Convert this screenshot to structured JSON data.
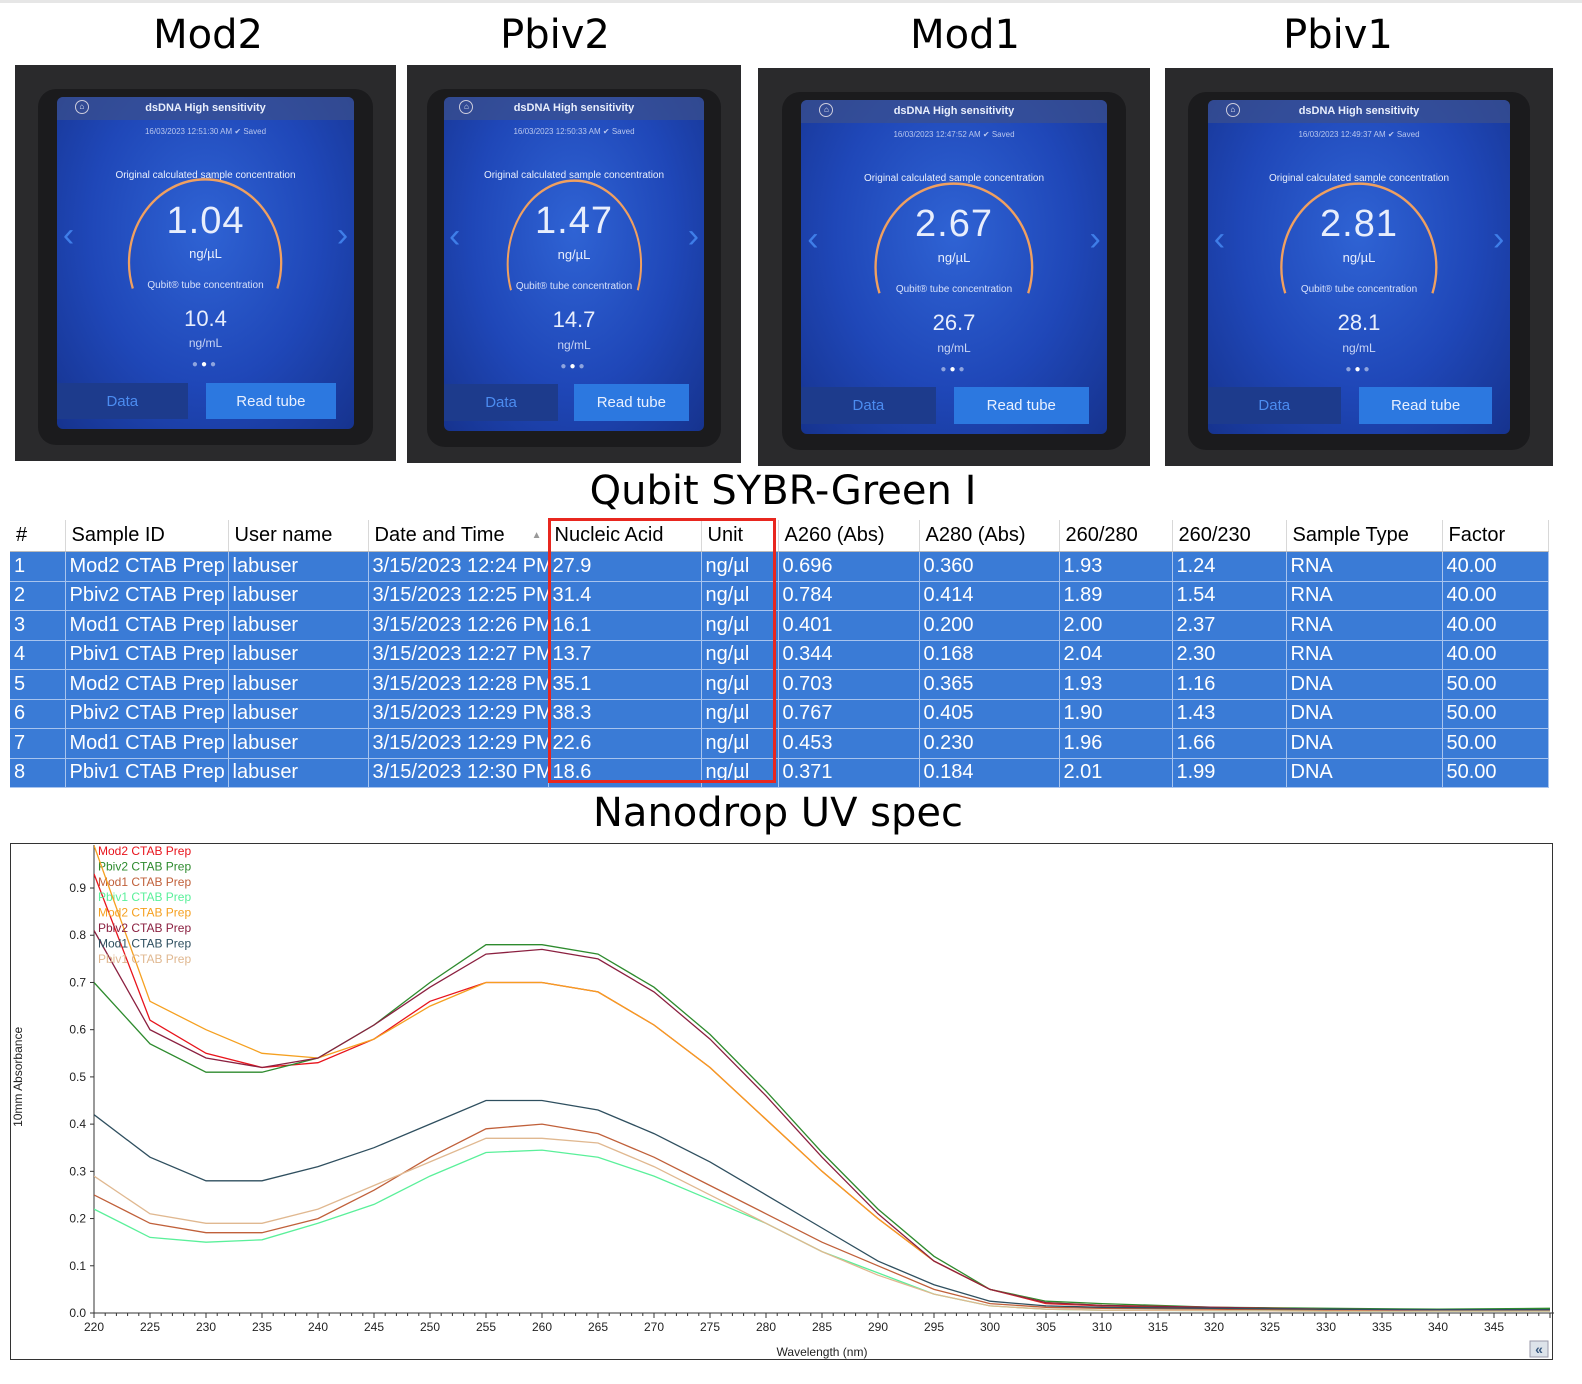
{
  "photos": [
    {
      "title": "Mod2",
      "header": "dsDNA High sensitivity",
      "timestamp": "16/03/2023 12:51:30 AM",
      "saved": "Saved",
      "orig_label": "Original calculated sample concentration",
      "value": "1.04",
      "unit": "ng/µL",
      "tube_label": "Qubit® tube concentration",
      "tube_value": "10.4",
      "tube_unit": "ng/mL",
      "data_btn": "Data",
      "read_btn": "Read tube"
    },
    {
      "title": "Pbiv2",
      "header": "dsDNA High sensitivity",
      "timestamp": "16/03/2023 12:50:33 AM",
      "saved": "Saved",
      "orig_label": "Original calculated sample concentration",
      "value": "1.47",
      "unit": "ng/µL",
      "tube_label": "Qubit® tube concentration",
      "tube_value": "14.7",
      "tube_unit": "ng/mL",
      "data_btn": "Data",
      "read_btn": "Read tube"
    },
    {
      "title": "Mod1",
      "header": "dsDNA High sensitivity",
      "timestamp": "16/03/2023 12:47:52 AM",
      "saved": "Saved",
      "orig_label": "Original calculated sample concentration",
      "value": "2.67",
      "unit": "ng/µL",
      "tube_label": "Qubit® tube concentration",
      "tube_value": "26.7",
      "tube_unit": "ng/mL",
      "data_btn": "Data",
      "read_btn": "Read tube"
    },
    {
      "title": "Pbiv1",
      "header": "dsDNA High sensitivity",
      "timestamp": "16/03/2023 12:49:37 AM",
      "saved": "Saved",
      "orig_label": "Original calculated sample concentration",
      "value": "2.81",
      "unit": "ng/µL",
      "tube_label": "Qubit® tube concentration",
      "tube_value": "28.1",
      "tube_unit": "ng/mL",
      "data_btn": "Data",
      "read_btn": "Read tube"
    }
  ],
  "qubit_title": "Qubit SYBR-Green I",
  "table": {
    "headers": [
      "#",
      "Sample ID",
      "User name",
      "Date and Time",
      "Nucleic Acid",
      "Unit",
      "A260 (Abs)",
      "A280 (Abs)",
      "260/280",
      "260/230",
      "Sample Type",
      "Factor"
    ],
    "rows": [
      [
        "1",
        "Mod2 CTAB Prep",
        "labuser",
        "3/15/2023 12:24 PM",
        "27.9",
        "ng/µl",
        "0.696",
        "0.360",
        "1.93",
        "1.24",
        "RNA",
        "40.00"
      ],
      [
        "2",
        "Pbiv2 CTAB Prep",
        "labuser",
        "3/15/2023 12:25 PM",
        "31.4",
        "ng/µl",
        "0.784",
        "0.414",
        "1.89",
        "1.54",
        "RNA",
        "40.00"
      ],
      [
        "3",
        "Mod1 CTAB Prep",
        "labuser",
        "3/15/2023 12:26 PM",
        "16.1",
        "ng/µl",
        "0.401",
        "0.200",
        "2.00",
        "2.37",
        "RNA",
        "40.00"
      ],
      [
        "4",
        "Pbiv1 CTAB Prep",
        "labuser",
        "3/15/2023 12:27 PM",
        "13.7",
        "ng/µl",
        "0.344",
        "0.168",
        "2.04",
        "2.30",
        "RNA",
        "40.00"
      ],
      [
        "5",
        "Mod2 CTAB Prep",
        "labuser",
        "3/15/2023 12:28 PM",
        "35.1",
        "ng/µl",
        "0.703",
        "0.365",
        "1.93",
        "1.16",
        "DNA",
        "50.00"
      ],
      [
        "6",
        "Pbiv2 CTAB Prep",
        "labuser",
        "3/15/2023 12:29 PM",
        "38.3",
        "ng/µl",
        "0.767",
        "0.405",
        "1.90",
        "1.43",
        "DNA",
        "50.00"
      ],
      [
        "7",
        "Mod1 CTAB Prep",
        "labuser",
        "3/15/2023 12:29 PM",
        "22.6",
        "ng/µl",
        "0.453",
        "0.230",
        "1.96",
        "1.66",
        "DNA",
        "50.00"
      ],
      [
        "8",
        "Pbiv1 CTAB Prep",
        "labuser",
        "3/15/2023 12:30 PM",
        "18.6",
        "ng/µl",
        "0.371",
        "0.184",
        "2.01",
        "1.99",
        "DNA",
        "50.00"
      ]
    ],
    "highlight_color": "#e8271f",
    "row_color": "#3a7bd6"
  },
  "nanodrop_title": "Nanodrop UV spec",
  "chart_data": {
    "type": "line",
    "xlabel": "Wavelength (nm)",
    "ylabel": "10mm Absorbance",
    "xlim": [
      220,
      350
    ],
    "ylim": [
      0,
      0.99
    ],
    "xticks": [
      220,
      225,
      230,
      235,
      240,
      245,
      250,
      255,
      260,
      265,
      270,
      275,
      280,
      285,
      290,
      295,
      300,
      305,
      310,
      315,
      320,
      325,
      330,
      335,
      340,
      345
    ],
    "yticks": [
      "0.0",
      "0.1",
      "0.2",
      "0.3",
      "0.4",
      "0.5",
      "0.6",
      "0.7",
      "0.8",
      "0.9"
    ],
    "legend_position": "top-left",
    "x": [
      220,
      225,
      230,
      235,
      240,
      245,
      250,
      255,
      260,
      265,
      270,
      275,
      280,
      285,
      290,
      295,
      300,
      305,
      310,
      320,
      330,
      340,
      350
    ],
    "series": [
      {
        "name": "Mod2 CTAB Prep",
        "color": "#e8141c",
        "values": [
          0.93,
          0.62,
          0.55,
          0.52,
          0.53,
          0.58,
          0.66,
          0.7,
          0.7,
          0.68,
          0.61,
          0.52,
          0.41,
          0.3,
          0.2,
          0.11,
          0.05,
          0.02,
          0.015,
          0.01,
          0.006,
          0.005,
          0.005
        ]
      },
      {
        "name": "Pbiv2 CTAB Prep",
        "color": "#2e8b2e",
        "values": [
          0.7,
          0.57,
          0.51,
          0.51,
          0.54,
          0.61,
          0.7,
          0.78,
          0.78,
          0.76,
          0.69,
          0.59,
          0.47,
          0.34,
          0.22,
          0.12,
          0.05,
          0.025,
          0.02,
          0.012,
          0.01,
          0.008,
          0.01
        ]
      },
      {
        "name": "Mod1 CTAB Prep",
        "color": "#c0603a",
        "values": [
          0.25,
          0.19,
          0.17,
          0.17,
          0.2,
          0.26,
          0.33,
          0.39,
          0.4,
          0.38,
          0.33,
          0.27,
          0.21,
          0.15,
          0.1,
          0.05,
          0.02,
          0.012,
          0.01,
          0.008,
          0.006,
          0.005,
          0.005
        ]
      },
      {
        "name": "Pbiv1 CTAB Prep",
        "color": "#5af09a",
        "values": [
          0.22,
          0.16,
          0.15,
          0.155,
          0.19,
          0.23,
          0.29,
          0.34,
          0.345,
          0.33,
          0.29,
          0.24,
          0.19,
          0.13,
          0.085,
          0.04,
          0.015,
          0.008,
          0.006,
          0.005,
          0.004,
          0.004,
          0.004
        ]
      },
      {
        "name": "Mod2 CTAB Prep",
        "color": "#f5a020",
        "values": [
          0.99,
          0.66,
          0.6,
          0.55,
          0.54,
          0.58,
          0.65,
          0.7,
          0.7,
          0.68,
          0.61,
          0.52,
          0.41,
          0.3,
          0.2,
          0.11,
          0.05,
          0.022,
          0.016,
          0.012,
          0.008,
          0.006,
          0.006
        ]
      },
      {
        "name": "Pbiv2 CTAB Prep",
        "color": "#8b2040",
        "values": [
          0.81,
          0.6,
          0.54,
          0.52,
          0.54,
          0.61,
          0.69,
          0.76,
          0.77,
          0.75,
          0.68,
          0.58,
          0.46,
          0.33,
          0.21,
          0.11,
          0.05,
          0.022,
          0.016,
          0.012,
          0.008,
          0.006,
          0.006
        ]
      },
      {
        "name": "Mod1 CTAB Prep",
        "color": "#2f4f5f",
        "values": [
          0.42,
          0.33,
          0.28,
          0.28,
          0.31,
          0.35,
          0.4,
          0.45,
          0.45,
          0.43,
          0.38,
          0.32,
          0.25,
          0.18,
          0.11,
          0.06,
          0.025,
          0.015,
          0.012,
          0.01,
          0.008,
          0.007,
          0.007
        ]
      },
      {
        "name": "Pbiv1 CTAB Prep",
        "color": "#e0b890",
        "values": [
          0.29,
          0.21,
          0.19,
          0.19,
          0.22,
          0.27,
          0.32,
          0.37,
          0.37,
          0.36,
          0.31,
          0.25,
          0.19,
          0.13,
          0.08,
          0.04,
          0.015,
          0.008,
          0.006,
          0.005,
          0.004,
          0.004,
          0.004
        ]
      }
    ],
    "collapse_button": "«"
  }
}
